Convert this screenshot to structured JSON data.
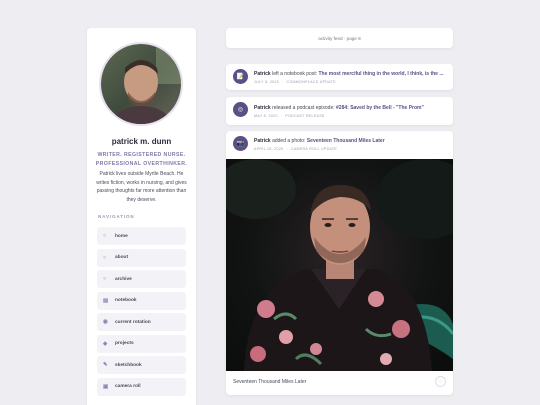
{
  "profile": {
    "name": "patrick m. dunn",
    "tagline": "WRITER. REGISTERED NURSE. PROFESSIONAL OVERTHINKER.",
    "bio": "Patrick lives outside Myrtle Beach. He writes fiction, works in nursing, and gives passing thoughts far more attention than they deserve."
  },
  "nav": {
    "heading": "NAVIGATION",
    "items": [
      {
        "icon": "○",
        "icon_name": "home-icon",
        "label": "home"
      },
      {
        "icon": "○",
        "icon_name": "about-icon",
        "label": "about"
      },
      {
        "icon": "○",
        "icon_name": "archive-icon",
        "label": "archive"
      },
      {
        "icon": "▤",
        "icon_name": "notebook-icon",
        "label": "notebook"
      },
      {
        "icon": "◉",
        "icon_name": "rotation-icon",
        "label": "current rotation"
      },
      {
        "icon": "◈",
        "icon_name": "projects-icon",
        "label": "projects"
      },
      {
        "icon": "✎",
        "icon_name": "sketchbook-icon",
        "label": "sketchbook"
      },
      {
        "icon": "▣",
        "icon_name": "camera-icon",
        "label": "camera roll"
      }
    ]
  },
  "feed": {
    "header": "activity feed · page 8",
    "posts": [
      {
        "icon": "📝",
        "icon_name": "notebook-post-icon",
        "author": "Patrick",
        "action": " left a notebook post: ",
        "link": "The most merciful thing in the world, I think, is the ...",
        "date": "JULY 8, 2020",
        "category": "COMMONPLACE UPDATE"
      },
      {
        "icon": "◎",
        "icon_name": "podcast-icon",
        "author": "Patrick",
        "action": " released a podcast episode: ",
        "link": "#284: Saved by the Bell - \"The Prom\"",
        "date": "MAY 8, 2020",
        "category": "PODCAST RELEASE"
      },
      {
        "icon": "📷",
        "icon_name": "camera-post-icon",
        "author": "Patrick",
        "action": " added a photo: ",
        "link": "Seventeen Thousand Miles Later",
        "date": "APRIL 15, 2020",
        "category": "CAMERA ROLL UPDATE",
        "caption": "Seventeen Thousand Miles Later"
      }
    ]
  },
  "colors": {
    "accent": "#5b4f86",
    "background": "#eeeef2",
    "card": "#ffffff"
  }
}
